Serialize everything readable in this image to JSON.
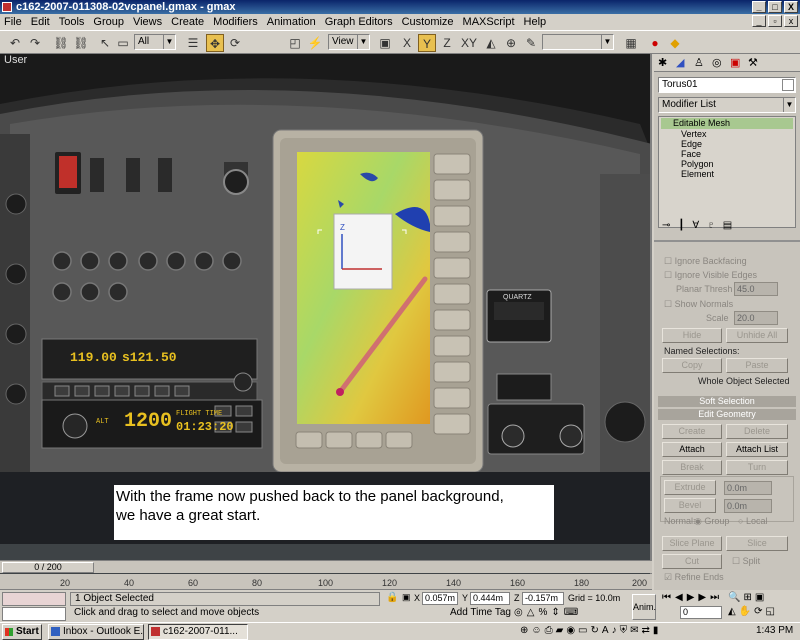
{
  "window": {
    "title": "c162-2007-011308-02vcpanel.gmax - gmax",
    "controls": [
      "_",
      "□",
      "X"
    ]
  },
  "menu": {
    "items": [
      "File",
      "Edit",
      "Tools",
      "Group",
      "Views",
      "Create",
      "Modifiers",
      "Animation",
      "Graph Editors",
      "Customize",
      "MAXScript",
      "Help"
    ],
    "doc_controls": [
      "_",
      "▫",
      "x"
    ]
  },
  "toolbar": {
    "selection_filter": "All",
    "reference_coord": "View",
    "axis_labels": [
      "X",
      "Y",
      "Z",
      "XY"
    ]
  },
  "viewport": {
    "label": "User",
    "radio": {
      "active": "119.00",
      "standby": "s121.50"
    },
    "transponder": {
      "mode": "ALT",
      "code": "1200",
      "label": "FLIGHT TIME",
      "time": "01:23:20"
    },
    "brand": "QUARTZ",
    "gizmo": {
      "axis": "Z"
    }
  },
  "caption": {
    "line1": "With the frame now pushed back to the panel background,",
    "line2": "we have a great start."
  },
  "command_panel": {
    "object_name": "Torus01",
    "modifier_list": "Modifier List",
    "stack": {
      "root": "Editable Mesh",
      "items": [
        "Vertex",
        "Edge",
        "Face",
        "Polygon",
        "Element"
      ]
    },
    "selection": {
      "ignore_backfacing": "Ignore Backfacing",
      "ignore_visible_edges": "Ignore Visible Edges",
      "planar_thresh_label": "Planar Thresh",
      "planar_thresh_value": "45.0",
      "show_normals": "Show Normals",
      "scale_label": "Scale",
      "scale_value": "20.0",
      "hide": "Hide",
      "unhide_all": "Unhide All",
      "named_selections": "Named Selections:",
      "copy": "Copy",
      "paste": "Paste",
      "status": "Whole Object Selected"
    },
    "soft_selection": "Soft Selection",
    "edit_geometry": {
      "title": "Edit Geometry",
      "create": "Create",
      "delete": "Delete",
      "attach": "Attach",
      "attach_list": "Attach List",
      "break": "Break",
      "turn": "Turn",
      "extrude": "Extrude",
      "extrude_value": "0.0m",
      "bevel": "Bevel",
      "bevel_value": "0.0m",
      "normal": "Normal:",
      "group": "Group",
      "local": "Local",
      "slice_plane": "Slice Plane",
      "slice": "Slice",
      "cut": "Cut",
      "split": "Split",
      "refine_ends": "Refine Ends"
    }
  },
  "timeline": {
    "slider": "0 / 200",
    "ticks": [
      "20",
      "40",
      "60",
      "80",
      "100",
      "120",
      "140",
      "160",
      "180",
      "200"
    ]
  },
  "status": {
    "selected": "1 Object Selected",
    "prompt": "Click and drag to select and move objects",
    "x": "0.057m",
    "y": "0.444m",
    "z": "-0.157m",
    "grid": "Grid = 10.0m",
    "add_time_tag": "Add Time Tag",
    "anim": "Anim.",
    "frame": "0"
  },
  "taskbar": {
    "start": "Start",
    "tasks": [
      "Inbox - Outlook E...",
      "c162-2007-011..."
    ],
    "clock": "1:43 PM"
  },
  "colors": {
    "title_bar": "#0a246a",
    "active_tool": "#e8c050",
    "rollout_header": "#a8a49c",
    "stack_highlight": "#a8c890"
  }
}
